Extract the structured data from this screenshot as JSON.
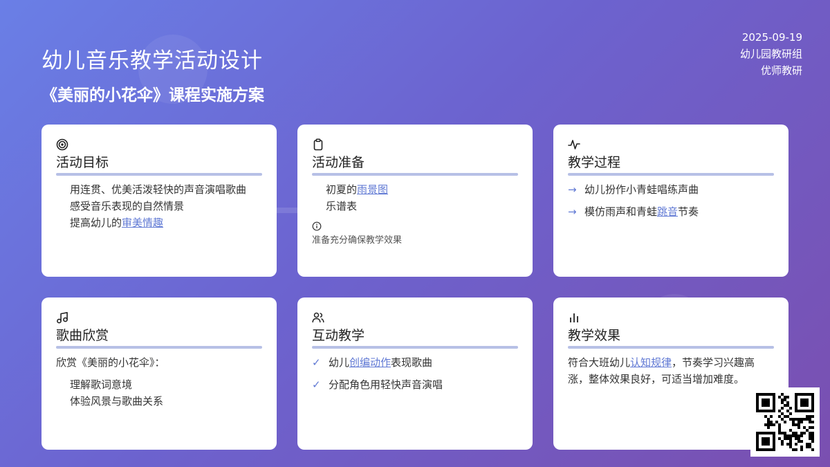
{
  "header": {
    "title": "幼儿音乐教学活动设计",
    "subtitle": "《美丽的小花伞》课程实施方案",
    "date": "2025-09-19",
    "org": "幼儿园教研组",
    "team": "优师教研"
  },
  "cards": {
    "goals": {
      "icon": "target-icon",
      "title": "活动目标",
      "items": [
        "用连贯、优美活泼轻快的声音演唱歌曲",
        "感受音乐表现的自然情景"
      ],
      "item3_prefix": "提高幼儿的",
      "item3_link": "审美情趣"
    },
    "prep": {
      "icon": "clipboard-icon",
      "title": "活动准备",
      "item1_prefix": "初夏的",
      "item1_link": "雨景图",
      "item2": "乐谱表",
      "note": "准备充分确保教学效果"
    },
    "process": {
      "icon": "activity-icon",
      "title": "教学过程",
      "item1": "幼儿扮作小青蛙唱练声曲",
      "item2_prefix": "模仿雨声和青蛙",
      "item2_link": "跳音",
      "item2_suffix": "节奏"
    },
    "appreciation": {
      "icon": "music-note-icon",
      "title": "歌曲欣赏",
      "intro": "欣赏《美丽的小花伞》：",
      "items": [
        "理解歌词意境",
        "体验风景与歌曲关系"
      ]
    },
    "interactive": {
      "icon": "users-icon",
      "title": "互动教学",
      "item1_prefix": "幼儿",
      "item1_link": "创编动作",
      "item1_suffix": "表现歌曲",
      "item2": "分配角色用轻快声音演唱"
    },
    "effect": {
      "icon": "bar-chart-icon",
      "title": "教学效果",
      "text_prefix": "符合大班幼儿",
      "text_link": "认知规律",
      "text_suffix": "，节奏学习兴趣高涨，整体效果良好，可适当增加难度。"
    }
  },
  "colors": {
    "accent": "#6079d4",
    "rule": "#b7c0e6",
    "bg_start": "#6a7fe6",
    "bg_end": "#7a4fb0"
  }
}
